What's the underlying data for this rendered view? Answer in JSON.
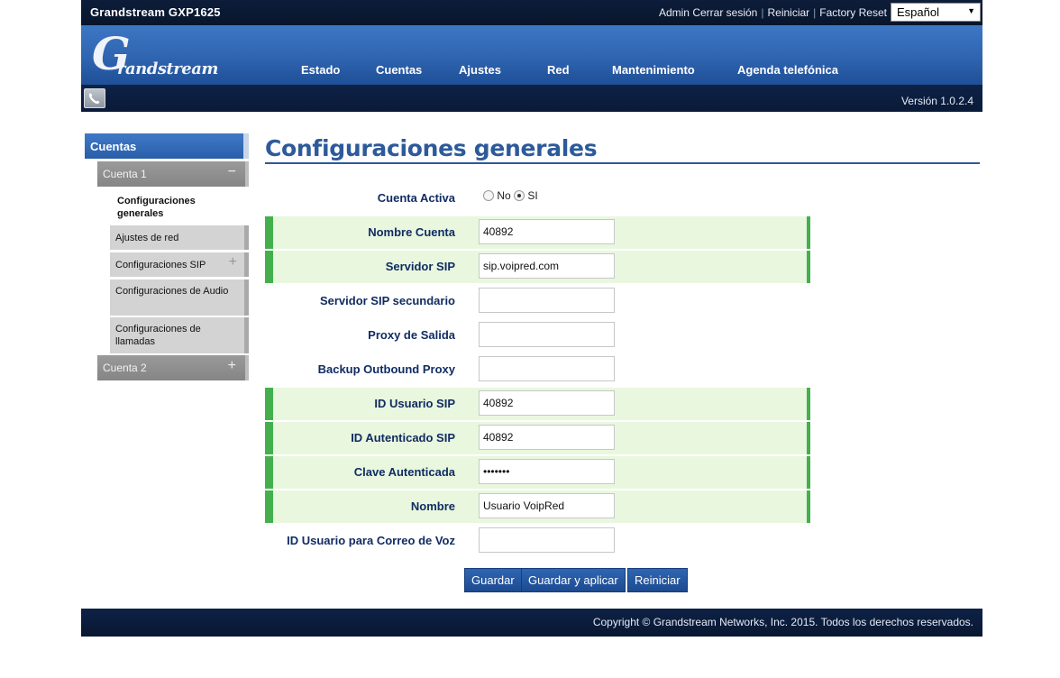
{
  "header": {
    "title": "Grandstream GXP1625",
    "links": [
      "Admin",
      "Cerrar sesión",
      "Reiniciar",
      "Factory Reset"
    ],
    "language": "Español"
  },
  "logo": {
    "first": "G",
    "rest": "randstream"
  },
  "nav": [
    "Estado",
    "Cuentas",
    "Ajustes",
    "Red",
    "Mantenimiento",
    "Agenda telefónica"
  ],
  "version": "Versión 1.0.2.4",
  "sidebar": {
    "heading": "Cuentas",
    "account1": "Cuenta 1",
    "account1_sign": "−",
    "items": [
      {
        "label": "Configuraciones generales"
      },
      {
        "label": "Ajustes de red"
      },
      {
        "label": "Configuraciones SIP",
        "sign": "+"
      },
      {
        "label": "Configuraciones de Audio"
      },
      {
        "label": "Configuraciones de llamadas"
      }
    ],
    "account2": "Cuenta 2",
    "account2_sign": "+"
  },
  "page": {
    "title": "Configuraciones generales",
    "cuenta_activa": {
      "label": "Cuenta Activa",
      "opt_no": "No",
      "opt_si": "SI",
      "selected": "SI"
    },
    "fields": [
      {
        "label": "Nombre Cuenta",
        "value": "40892",
        "highlight": true
      },
      {
        "label": "Servidor SIP",
        "value": "sip.voipred.com",
        "highlight": true
      },
      {
        "label": "Servidor SIP secundario",
        "value": "",
        "highlight": false
      },
      {
        "label": "Proxy de Salida",
        "value": "",
        "highlight": false
      },
      {
        "label": "Backup Outbound Proxy",
        "value": "",
        "highlight": false
      },
      {
        "label": "ID Usuario SIP",
        "value": "40892",
        "highlight": true
      },
      {
        "label": "ID Autenticado SIP",
        "value": "40892",
        "highlight": true
      },
      {
        "label": "Clave Autenticada",
        "value": "1234567",
        "highlight": true,
        "type": "password"
      },
      {
        "label": "Nombre",
        "value": "Usuario VoipRed",
        "highlight": true
      },
      {
        "label": "ID Usuario para Correo de Voz",
        "value": "",
        "highlight": false
      }
    ],
    "buttons": {
      "save": "Guardar",
      "save_apply": "Guardar y aplicar",
      "reset": "Reiniciar"
    }
  },
  "footer": {
    "copyright": "Copyright © Grandstream Networks, Inc. 2015. Todos los derechos reservados."
  }
}
